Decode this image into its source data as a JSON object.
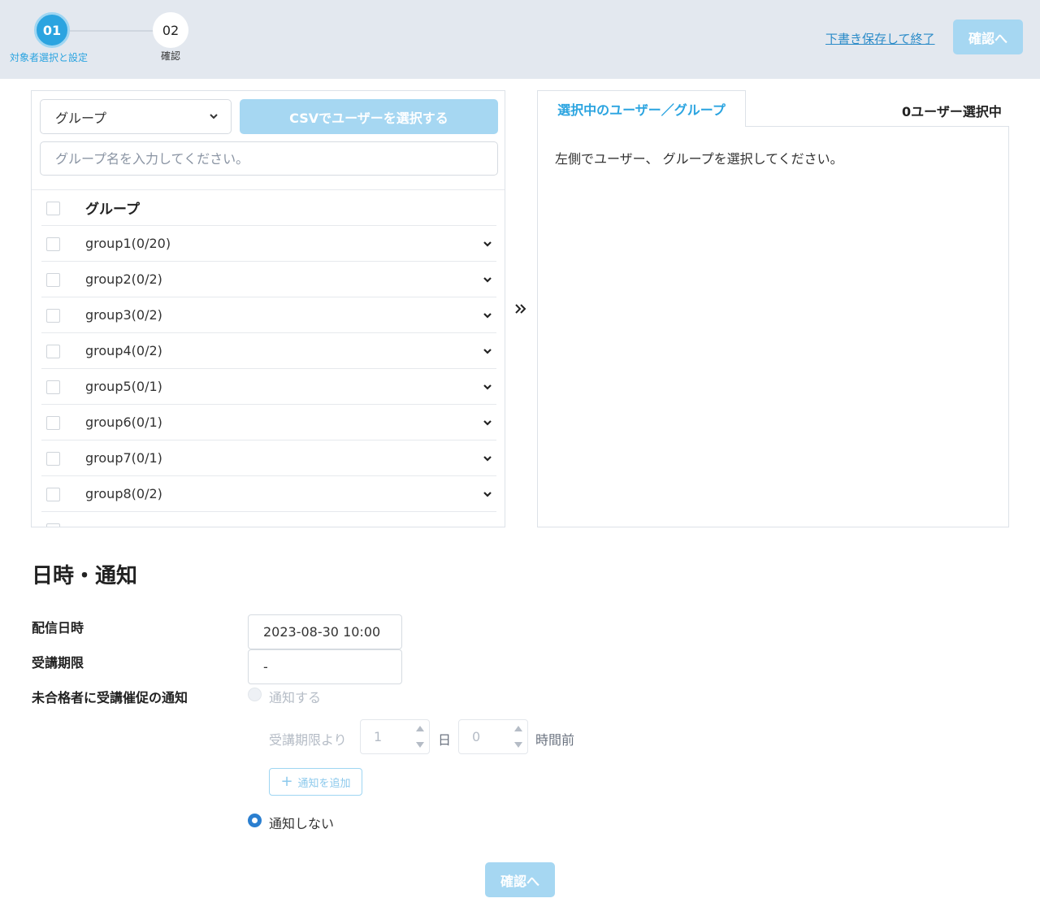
{
  "stepper": {
    "step1": {
      "number": "01",
      "label": "対象者選択と設定"
    },
    "step2": {
      "number": "02",
      "label": "確認"
    }
  },
  "header": {
    "draft_save_label": "下書き保存して終了",
    "confirm_label": "確認へ"
  },
  "left_panel": {
    "select_value": "グループ",
    "csv_button_label": "CSVでユーザーを選択する",
    "search_placeholder": "グループ名を入力してください。",
    "list_header": "グループ",
    "groups": [
      {
        "label": "group1(0/20)"
      },
      {
        "label": "group2(0/2)"
      },
      {
        "label": "group3(0/2)"
      },
      {
        "label": "group4(0/2)"
      },
      {
        "label": "group5(0/1)"
      },
      {
        "label": "group6(0/1)"
      },
      {
        "label": "group7(0/1)"
      },
      {
        "label": "group8(0/2)"
      }
    ]
  },
  "right_panel": {
    "tab_label": "選択中のユーザー／グループ",
    "selected_count": "0ユーザー選択中",
    "empty_message": "左側でユーザー、 グループを選択してください。"
  },
  "schedule": {
    "section_title": "日時・通知",
    "delivery_label": "配信日時",
    "delivery_value": "2023-08-30 10:00",
    "deadline_label": "受講期限",
    "deadline_value": "-",
    "reminder_label": "未合格者に受講催促の通知",
    "notify_option": "通知する",
    "from_deadline_text": "受講期限より",
    "days_value": "1",
    "days_unit": "日",
    "hours_value": "0",
    "hours_unit": "時間前",
    "add_notification_label": "通知を追加",
    "no_notify_option": "通知しない"
  },
  "footer": {
    "confirm_label": "確認へ"
  },
  "colors": {
    "accent": "#2ba4e0",
    "disabled_button": "#a6d7f2",
    "header_bg": "#e3e8ef"
  }
}
